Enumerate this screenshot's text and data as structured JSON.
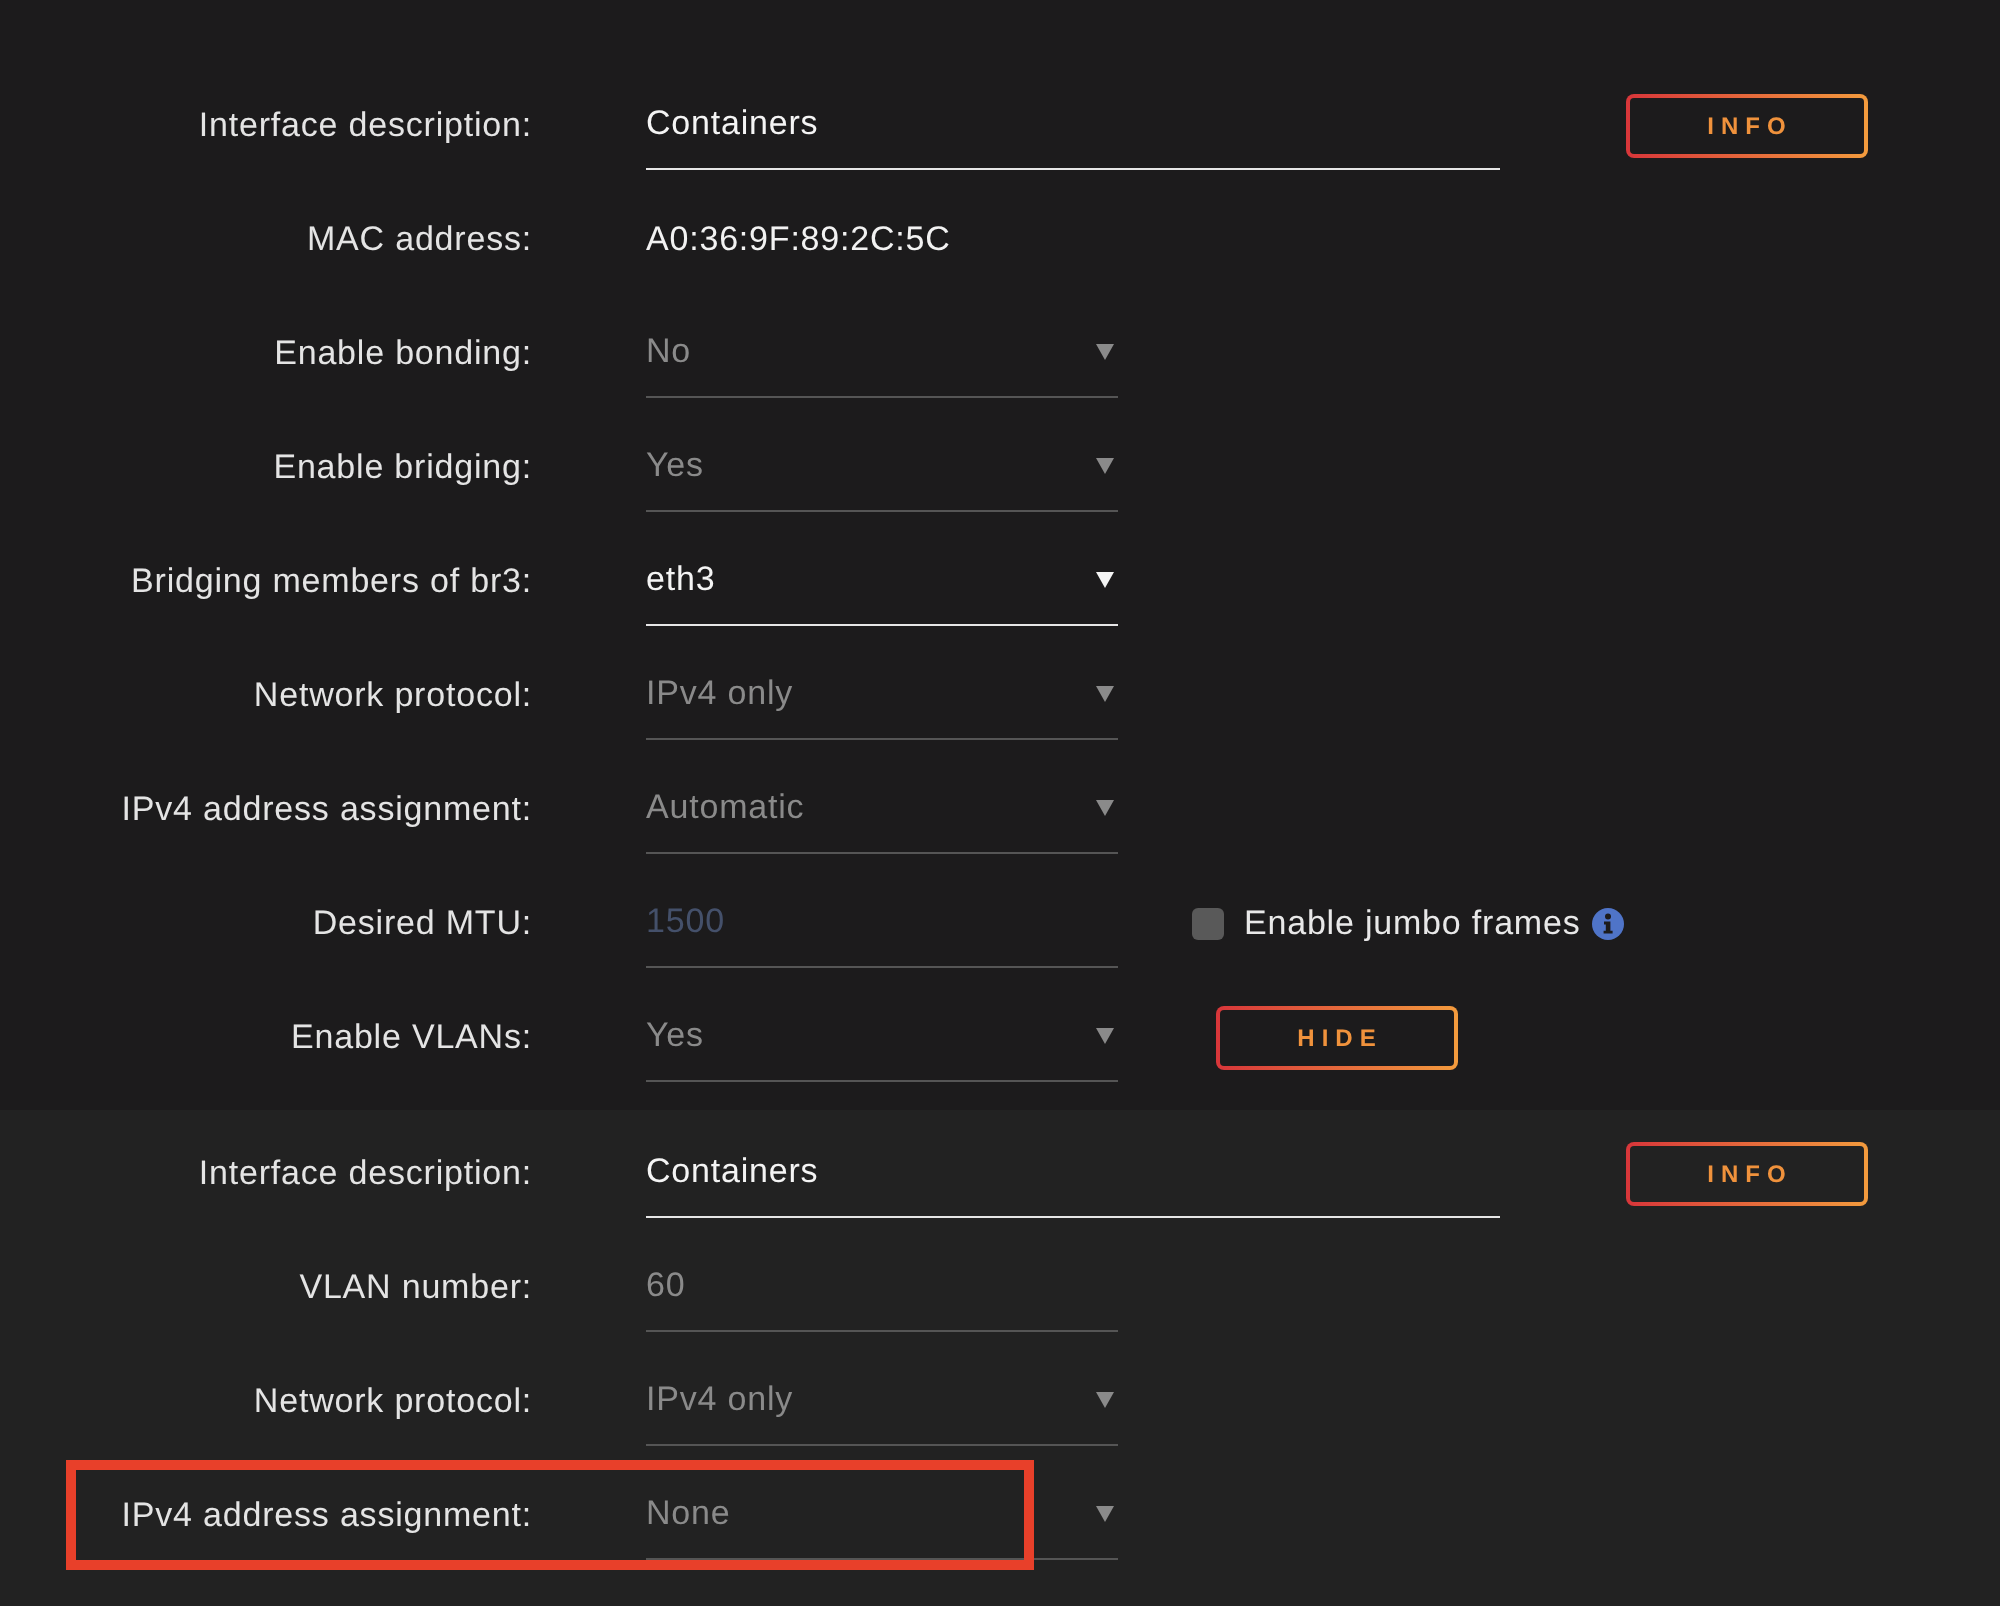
{
  "sections": [
    {
      "kind": "interface",
      "rows": [
        {
          "kind": "text",
          "label": "Interface description:",
          "value": "Containers",
          "disabled": false,
          "button": "INFO"
        },
        {
          "kind": "static",
          "label": "MAC address:",
          "value": "A0:36:9F:89:2C:5C"
        },
        {
          "kind": "select",
          "label": "Enable bonding:",
          "value": "No",
          "disabled": true
        },
        {
          "kind": "select",
          "label": "Enable bridging:",
          "value": "Yes",
          "disabled": true
        },
        {
          "kind": "select",
          "label": "Bridging members of br3:",
          "value": "eth3",
          "disabled": false
        },
        {
          "kind": "select",
          "label": "Network protocol:",
          "value": "IPv4 only",
          "disabled": true
        },
        {
          "kind": "select",
          "label": "IPv4 address assignment:",
          "value": "Automatic",
          "disabled": true
        },
        {
          "kind": "number",
          "label": "Desired MTU:",
          "placeholder": "1500",
          "disabled": true,
          "checkbox": {
            "label": "Enable jumbo frames",
            "checked": false
          }
        },
        {
          "kind": "select",
          "label": "Enable VLANs:",
          "value": "Yes",
          "disabled": true,
          "button": "HIDE"
        }
      ]
    },
    {
      "kind": "vlan",
      "rows": [
        {
          "kind": "text",
          "label": "Interface description:",
          "value": "Containers",
          "disabled": false,
          "button": "INFO"
        },
        {
          "kind": "number",
          "label": "VLAN number:",
          "value": "60",
          "disabled": true
        },
        {
          "kind": "select",
          "label": "Network protocol:",
          "value": "IPv4 only",
          "disabled": true
        },
        {
          "kind": "select",
          "label": "IPv4 address assignment:",
          "value": "None",
          "disabled": true,
          "highlighted": true
        }
      ]
    }
  ]
}
